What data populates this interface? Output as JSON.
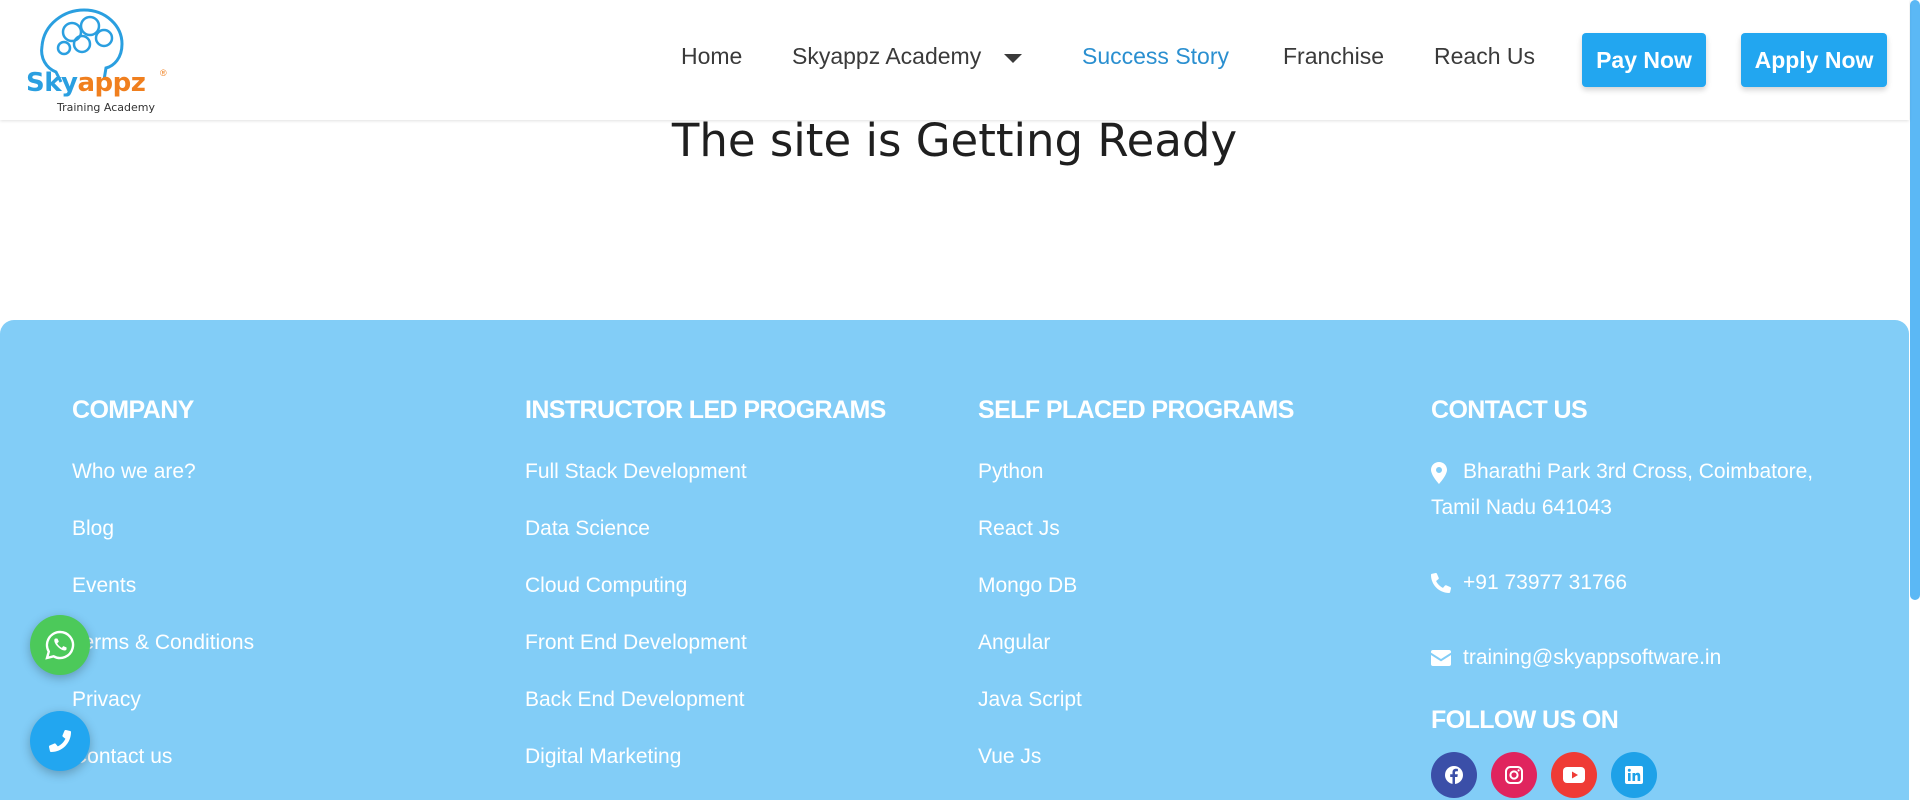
{
  "logo": {
    "brand_a": "Sky",
    "brand_b": "appz",
    "tagline": "Training Academy",
    "reg": "®"
  },
  "nav": {
    "home": "Home",
    "academy": "Skyappz Academy",
    "success": "Success Story",
    "franchise": "Franchise",
    "reach": "Reach Us",
    "pay": "Pay Now",
    "apply": "Apply Now"
  },
  "hero": {
    "title": "The site is Getting Ready"
  },
  "footer": {
    "company": {
      "title": "COMPANY",
      "links": [
        "Who we are?",
        "Blog",
        "Events",
        "Terms & Conditions",
        "Privacy",
        "Contact us"
      ]
    },
    "instructor": {
      "title": "INSTRUCTOR LED PROGRAMS",
      "links": [
        "Full Stack Development",
        "Data Science",
        "Cloud Computing",
        "Front End Development",
        "Back End Development",
        "Digital Marketing"
      ]
    },
    "self": {
      "title": "SELF PLACED PROGRAMS",
      "links": [
        "Python",
        "React Js",
        "Mongo DB",
        "Angular",
        "Java Script",
        "Vue Js"
      ]
    },
    "contact": {
      "title": "CONTACT US",
      "address_1": "Bharathi Park 3rd Cross, Coimbatore,",
      "address_2": "Tamil Nadu 641043",
      "phone": "+91 73977 31766",
      "email": "training@skyappsoftware.in",
      "follow": "FOLLOW US ON"
    }
  },
  "icons": {
    "nav_caret": "caret-down-icon",
    "address": "map-marker-icon",
    "phone": "phone-icon",
    "email": "envelope-icon",
    "social": [
      "facebook-icon",
      "instagram-icon",
      "youtube-icon",
      "linkedin-icon"
    ],
    "floating": [
      "whatsapp-icon",
      "phone-icon"
    ]
  },
  "colors": {
    "accent": "#22a6f0",
    "active_nav": "#2a8fd0",
    "footer_bg": "#82cdf7",
    "facebook": "#3b4fa8",
    "instagram": "#e0245e",
    "youtube": "#ef3b35",
    "linkedin": "#1ea1e8",
    "whatsapp": "#4cc95a"
  }
}
